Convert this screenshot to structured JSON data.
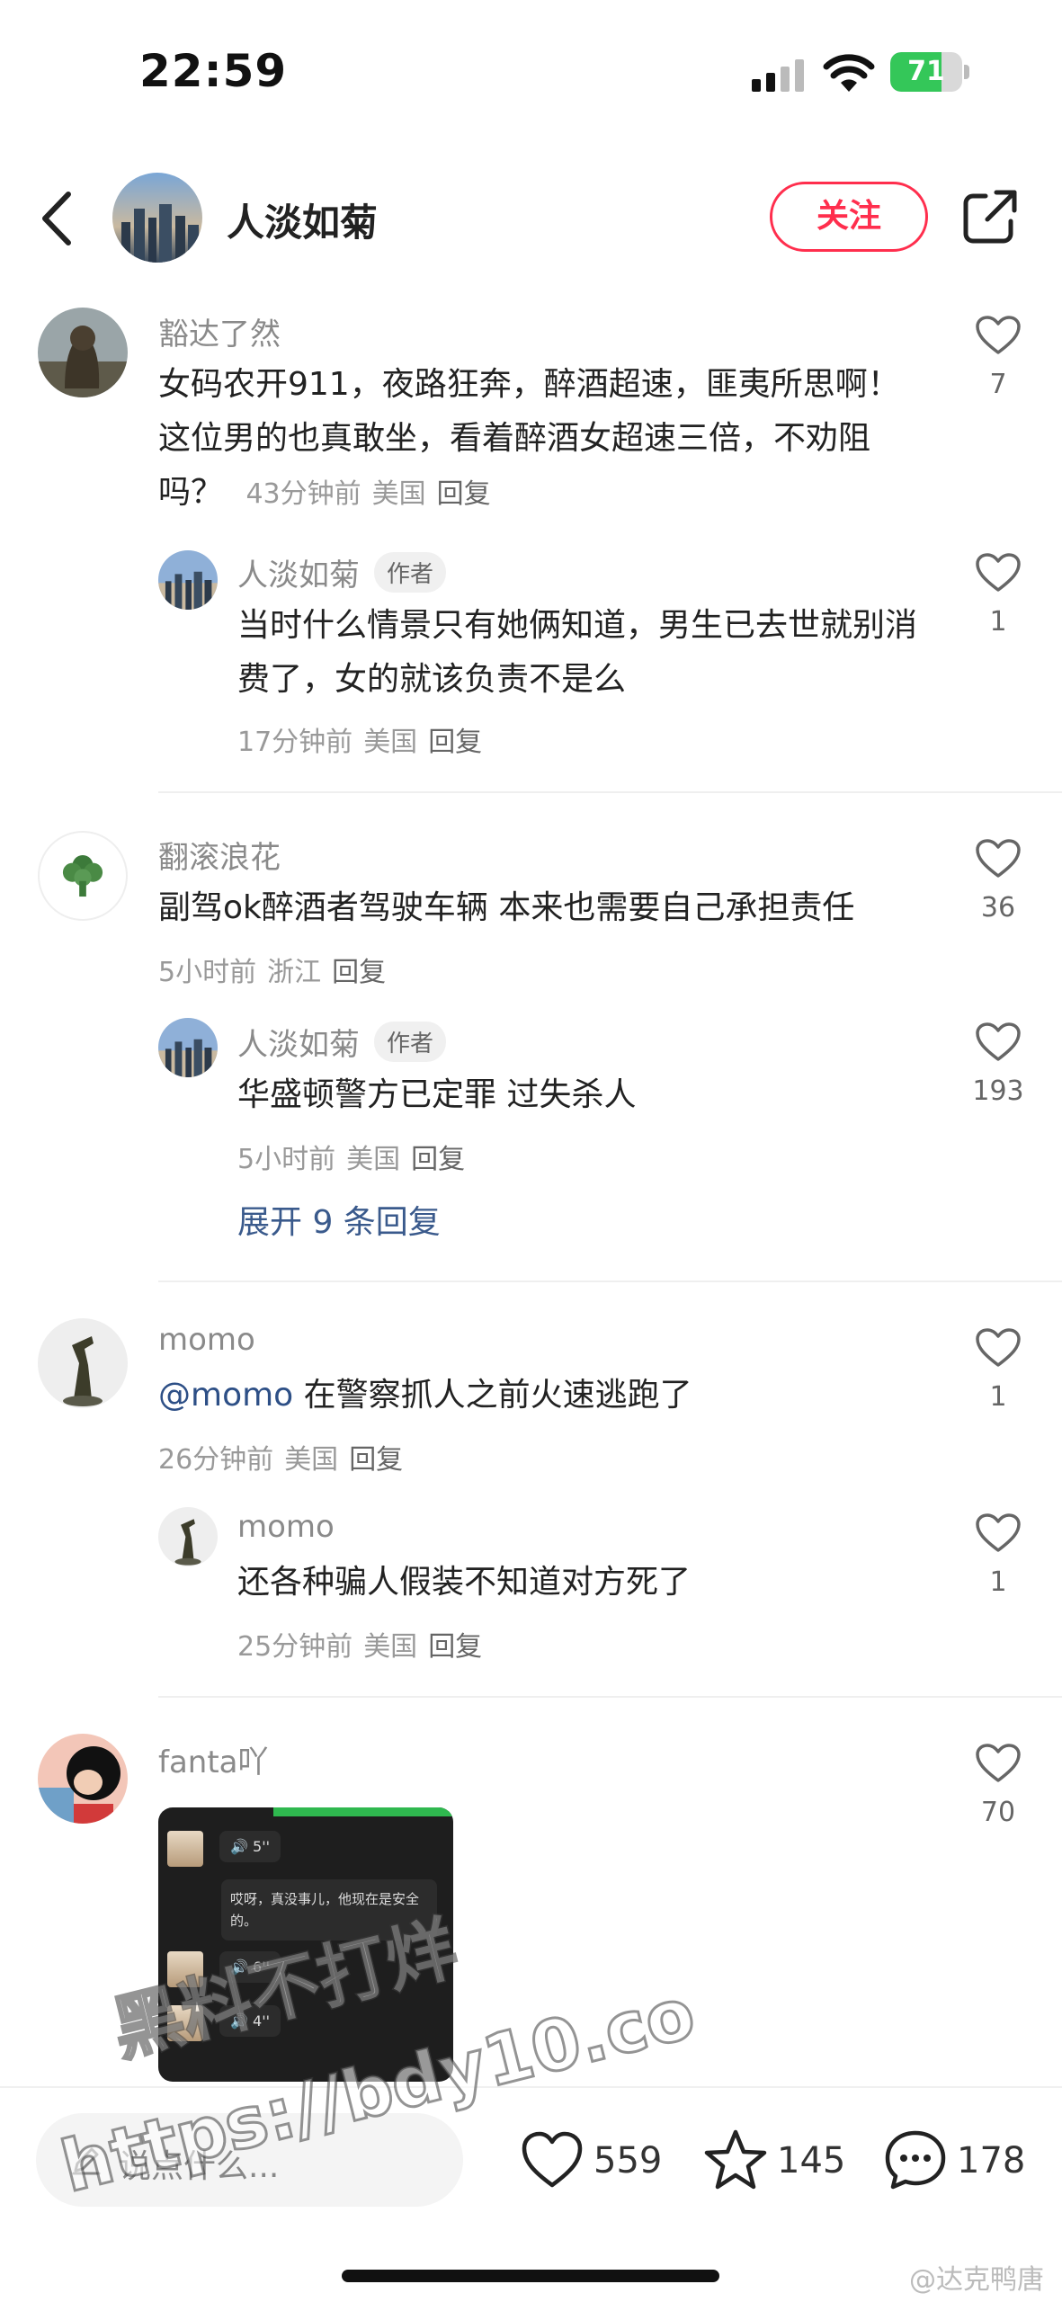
{
  "status": {
    "time": "22:59",
    "battery": "71",
    "battery_level": 0.71
  },
  "header": {
    "name": "人淡如菊",
    "follow_label": "关注"
  },
  "comments": [
    {
      "username": "豁达了然",
      "text": "女码农开911，夜路狂奔，醉酒超速，匪夷所思啊！这位男的也真敢坐，看着醉酒女超速三倍，不劝阻吗？",
      "time": "43分钟前",
      "location": "美国",
      "reply": "回复",
      "likes": "7",
      "replies": [
        {
          "username": "人淡如菊",
          "badge": "作者",
          "text": "当时什么情景只有她俩知道，男生已去世就别消费了，女的就该负责不是么",
          "time": "17分钟前",
          "location": "美国",
          "reply": "回复",
          "likes": "1"
        }
      ]
    },
    {
      "username": "翻滚浪花",
      "text": "副驾ok醉酒者驾驶车辆 本来也需要自己承担责任",
      "time": "5小时前",
      "location": "浙江",
      "reply": "回复",
      "likes": "36",
      "replies": [
        {
          "username": "人淡如菊",
          "badge": "作者",
          "text": "华盛顿警方已定罪 过失杀人",
          "time": "5小时前",
          "location": "美国",
          "reply": "回复",
          "likes": "193"
        }
      ],
      "expand": "展开 9 条回复"
    },
    {
      "username": "momo",
      "mention": "@momo",
      "text": " 在警察抓人之前火速逃跑了",
      "time": "26分钟前",
      "location": "美国",
      "reply": "回复",
      "likes": "1",
      "replies": [
        {
          "username": "momo",
          "text": "还各种骗人假装不知道对方死了",
          "time": "25分钟前",
          "location": "美国",
          "reply": "回复",
          "likes": "1"
        }
      ]
    },
    {
      "username": "fanta吖",
      "likes": "70",
      "image": {
        "voice1": "5''",
        "message": "哎呀，真没事儿，他现在是安全的。",
        "voice2": "6''",
        "voice3": "4''"
      }
    }
  ],
  "bottom": {
    "placeholder": "说点什么...",
    "likes": "559",
    "favorites": "145",
    "comments": "178"
  },
  "watermark": {
    "line1": "黑料不打烊",
    "line2": "https://bdy10.co"
  },
  "corner_mark": "@达克鸭唐",
  "colors": {
    "accent": "#ff2e4d",
    "link": "#2d4f86",
    "battery": "#34c759"
  }
}
